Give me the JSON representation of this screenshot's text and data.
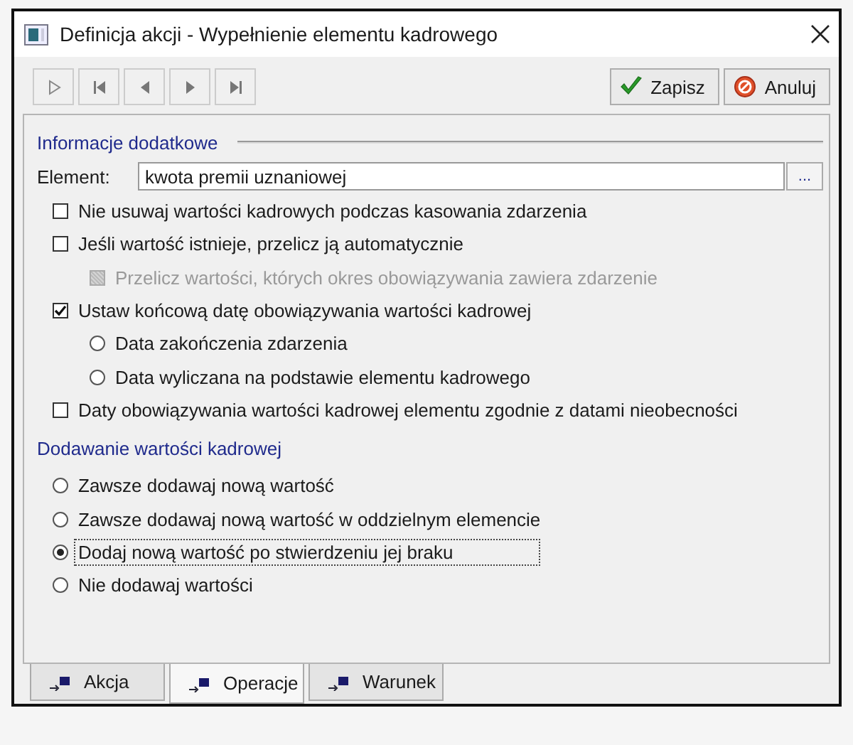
{
  "window": {
    "title": "Definicja akcji - Wypełnienie elementu kadrowego"
  },
  "toolbar": {
    "nav_buttons": [
      {
        "kind": "play"
      },
      {
        "kind": "first"
      },
      {
        "kind": "prev"
      },
      {
        "kind": "next"
      },
      {
        "kind": "last"
      }
    ],
    "buttons": [
      {
        "label": "Zapisz",
        "kind": "save"
      },
      {
        "label": "Anuluj",
        "kind": "cancel"
      }
    ]
  },
  "sections": [
    {
      "title": "Informacje dodatkowe",
      "rule": true,
      "field": {
        "label": "Element:",
        "value": "kwota premii uznaniowej",
        "button": "..."
      },
      "options": [
        {
          "kind": "checkbox",
          "label": "Nie usuwaj wartości kadrowych podczas kasowania zdarzenia",
          "checked": false,
          "disabled": false
        },
        {
          "kind": "checkbox",
          "label": "Jeśli wartość istnieje, przelicz ją automatycznie",
          "checked": false,
          "disabled": false,
          "children": [
            {
              "kind": "checkbox",
              "label": "Przelicz wartości, których okres obowiązywania zawiera zdarzenie",
              "checked": false,
              "disabled": true
            }
          ]
        },
        {
          "kind": "checkbox",
          "label": "Ustaw końcową datę obowiązywania wartości kadrowej",
          "checked": true,
          "disabled": false,
          "children": [
            {
              "kind": "radio",
              "label": "Data zakończenia zdarzenia",
              "selected": false
            },
            {
              "kind": "radio",
              "label": "Data wyliczana na podstawie elementu kadrowego",
              "selected": false
            }
          ]
        },
        {
          "kind": "checkbox",
          "label": "Daty obowiązywania wartości kadrowej elementu zgodnie z datami nieobecności",
          "checked": false,
          "disabled": false
        }
      ]
    },
    {
      "title": "Dodawanie wartości kadrowej",
      "rule": false,
      "options": [
        {
          "kind": "radio",
          "label": "Zawsze dodawaj nową wartość",
          "selected": false,
          "focused": false
        },
        {
          "kind": "radio",
          "label": "Zawsze dodawaj nową wartość w oddzielnym elemencie",
          "selected": false,
          "focused": false
        },
        {
          "kind": "radio",
          "label": "Dodaj nową wartość po stwierdzeniu jej braku",
          "selected": true,
          "focused": true
        },
        {
          "kind": "radio",
          "label": "Nie dodawaj wartości",
          "selected": false,
          "focused": false
        }
      ]
    }
  ],
  "tabs": [
    {
      "label": "Akcja",
      "selected": false
    },
    {
      "label": "Operacje",
      "selected": true
    },
    {
      "label": "Warunek",
      "selected": false
    }
  ]
}
